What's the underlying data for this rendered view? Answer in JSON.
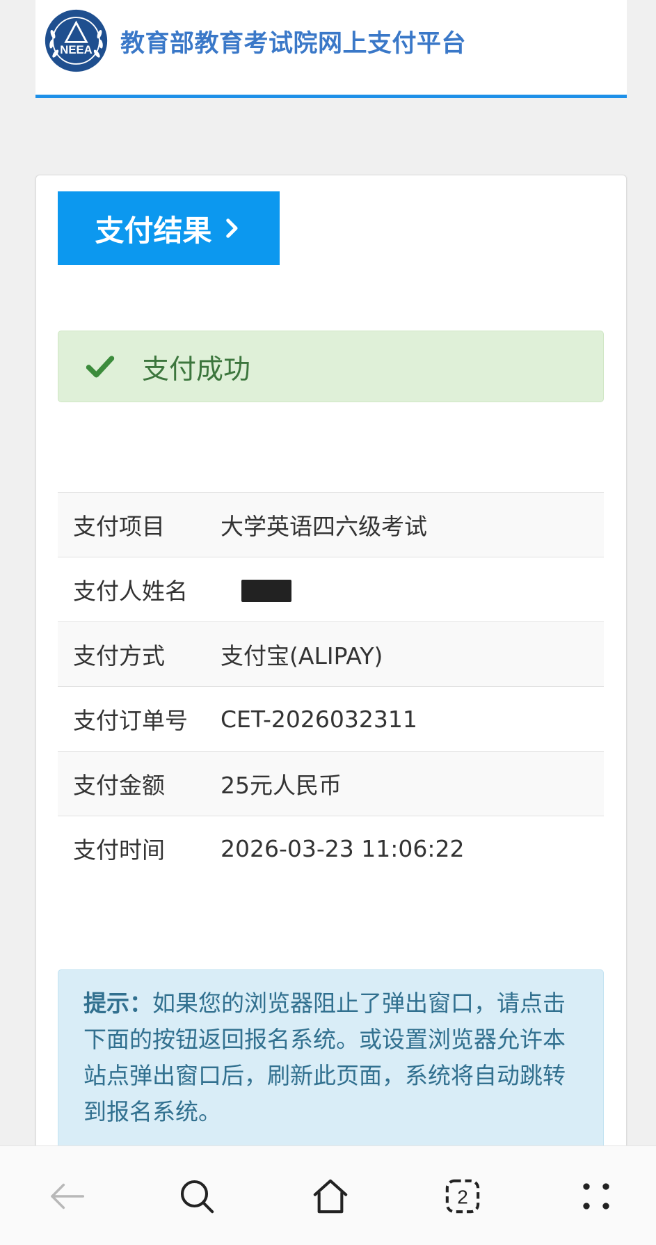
{
  "header": {
    "logo_text": "NEEA",
    "title": "教育部教育考试院网上支付平台",
    "accent_color": "#1e90e8"
  },
  "result_tab": {
    "label": "支付结果",
    "icon": "chevron-right-icon"
  },
  "alert": {
    "icon": "check-icon",
    "text": "支付成功",
    "color": "#3c763d"
  },
  "details": [
    {
      "label": "支付项目",
      "value": "大学英语四六级考试"
    },
    {
      "label": "支付人姓名",
      "value": "",
      "redacted": true
    },
    {
      "label": "支付方式",
      "value": "支付宝(ALIPAY)"
    },
    {
      "label": "支付订单号",
      "value": "CET-2026032311"
    },
    {
      "label": "支付金额",
      "value": "25元人民币"
    },
    {
      "label": "支付时间",
      "value": "2026-03-23 11:06:22"
    }
  ],
  "hint": {
    "label": "提示：",
    "text": "如果您的浏览器阻止了弹出窗口，请点击下面的按钮返回报名系统。或设置浏览器允许本站点弹出窗口后，刷新此页面，系统将自动跳转到报名系统。"
  },
  "bottom_nav": {
    "tab_count": "2",
    "icons": [
      "back-arrow-icon",
      "search-icon",
      "home-icon",
      "tabs-icon",
      "menu-icon"
    ]
  }
}
